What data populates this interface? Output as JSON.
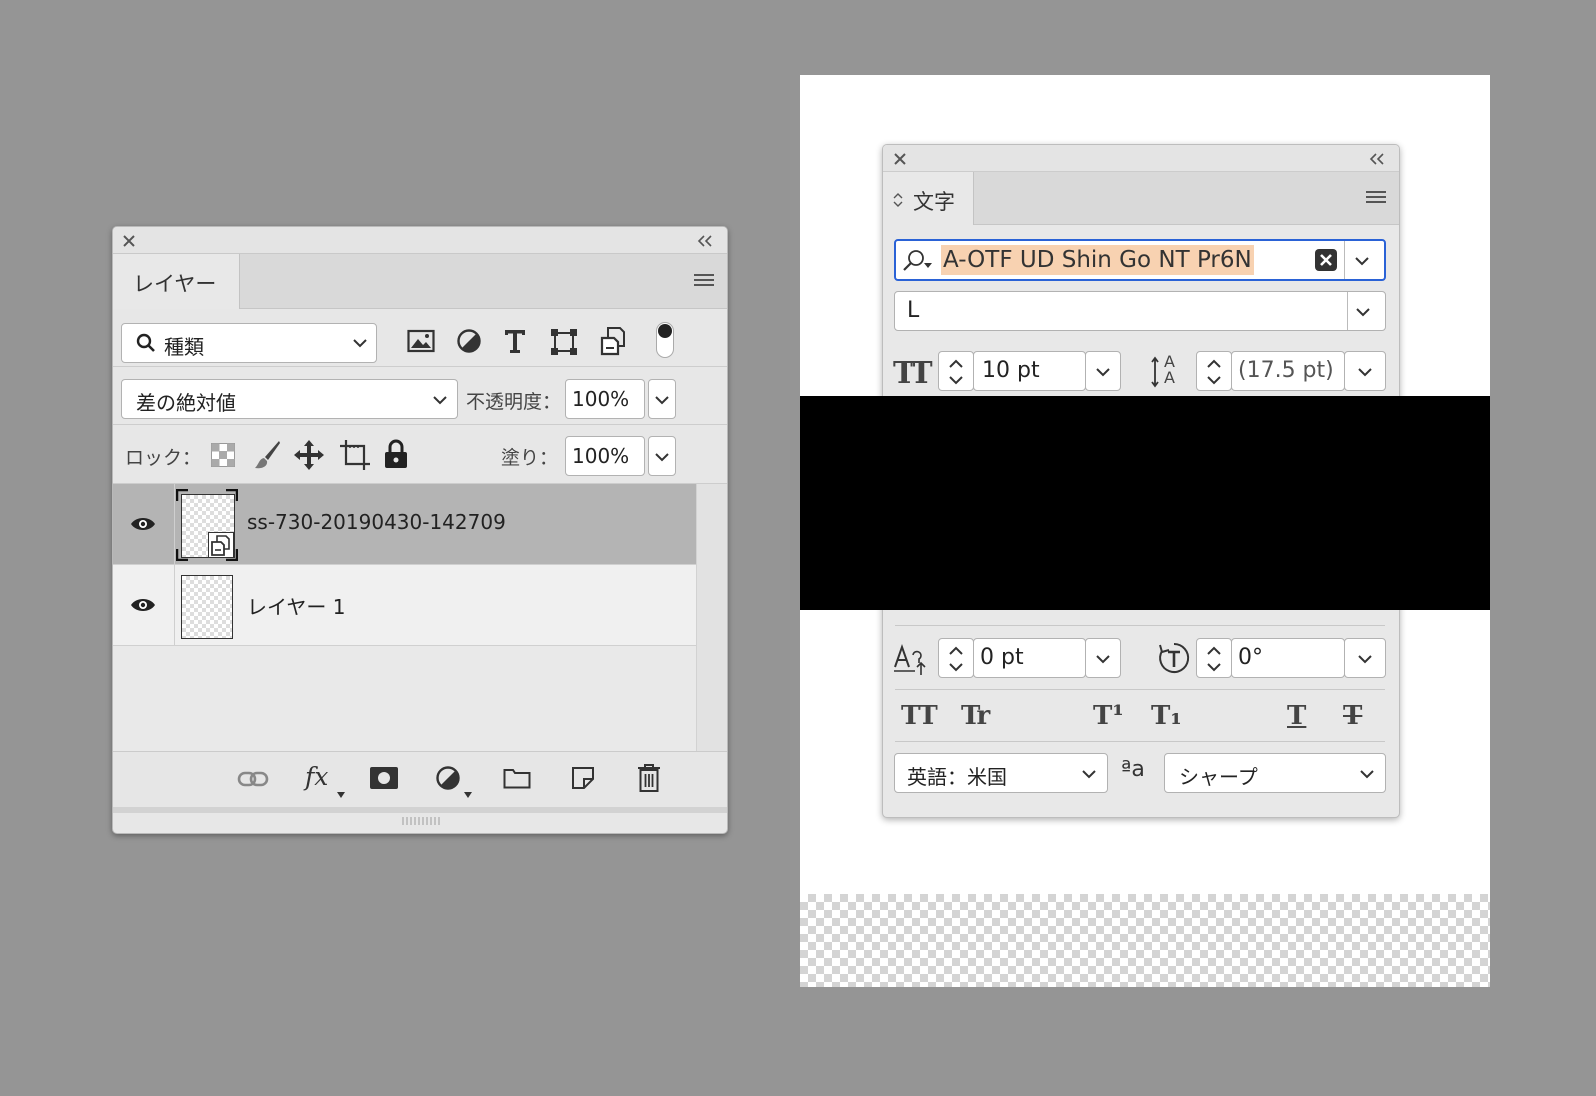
{
  "layers_panel": {
    "tab_label": "レイヤー",
    "filter": {
      "label": "種類"
    },
    "blend_mode": "差の絶対値",
    "opacity": {
      "label": "不透明度：",
      "value": "100%"
    },
    "lock": {
      "label": "ロック："
    },
    "fill": {
      "label": "塗り：",
      "value": "100%"
    },
    "layers": [
      {
        "name": "ss-730-20190430-142709",
        "visible": true,
        "selected": true,
        "smart_object": true
      },
      {
        "name": "レイヤー 1",
        "visible": true,
        "selected": false,
        "smart_object": false
      }
    ],
    "bottom_icons": [
      "link-icon",
      "fx-icon",
      "mask-icon",
      "adjustment-icon",
      "folder-icon",
      "new-layer-icon",
      "trash-icon"
    ],
    "fx_label": "fx"
  },
  "character_panel": {
    "tab_label": "文字",
    "font_family": "A-OTF UD Shin Go NT Pr6N",
    "font_style": "L",
    "font_size": "10 pt",
    "leading": "(17.5 pt)",
    "baseline_shift": "0 pt",
    "rotation": "0°",
    "language": "英語：米国",
    "antialias_glyph": "ªa",
    "antialias": "シャープ",
    "style_buttons": [
      "TT",
      "Tr",
      "T¹",
      "T₁",
      "T",
      "T"
    ],
    "font_size_icon_label": "TT",
    "leading_icon_label": "A"
  },
  "colors": {
    "background": "#959595",
    "selected_layer": "#b4b4b4",
    "font_highlight": "#f8d2b1",
    "focus_border": "#2a62d6"
  }
}
